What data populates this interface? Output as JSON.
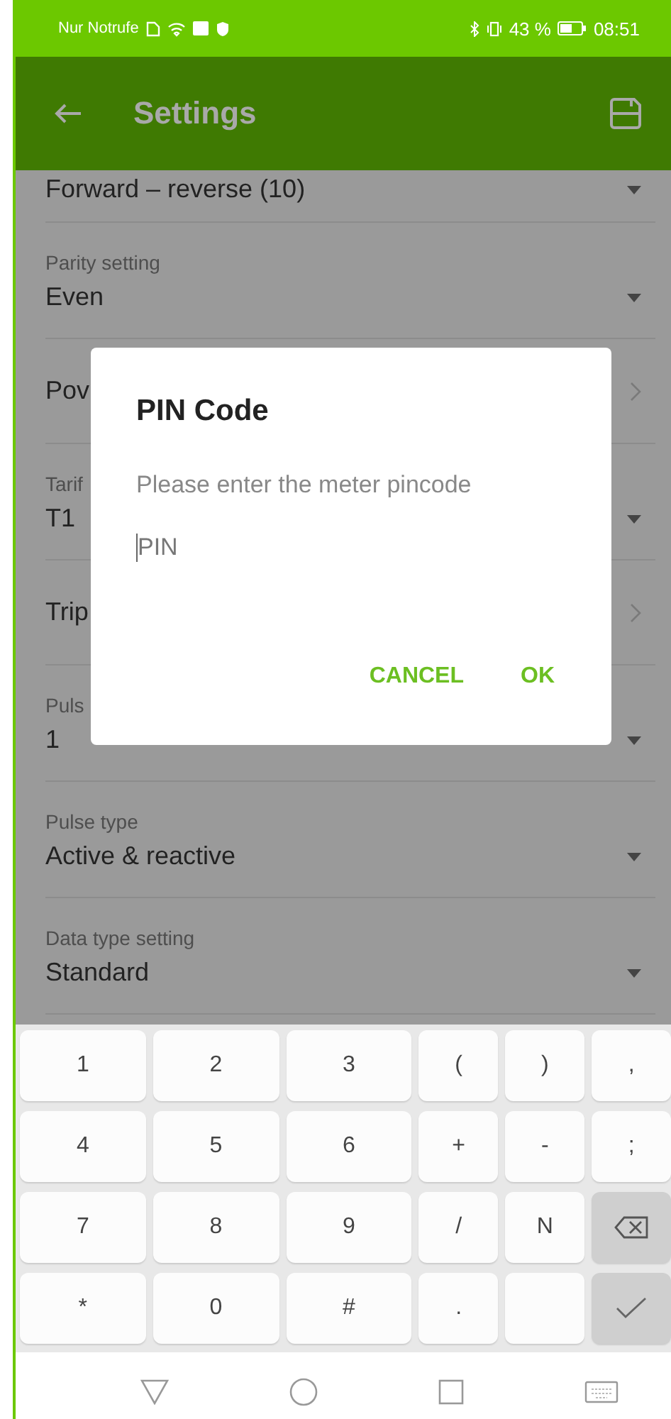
{
  "status_bar": {
    "carrier": "Nur Notrufe",
    "battery_percent": "43 %",
    "time": "08:51"
  },
  "app_bar": {
    "title": "Settings"
  },
  "settings": [
    {
      "kind": "select",
      "value": "Forward – reverse (10)"
    },
    {
      "kind": "select",
      "label": "Parity setting",
      "value": "Even"
    },
    {
      "kind": "link",
      "value": "Pov"
    },
    {
      "kind": "select",
      "label": "Tarif",
      "value": "T1"
    },
    {
      "kind": "link",
      "value": "Trip"
    },
    {
      "kind": "select",
      "label": "Puls",
      "value": "1"
    },
    {
      "kind": "select",
      "label": "Pulse type",
      "value": "Active & reactive"
    },
    {
      "kind": "select",
      "label": "Data type setting",
      "value": "Standard"
    }
  ],
  "dialog": {
    "title": "PIN Code",
    "message": "Please enter the meter pincode",
    "input": {
      "placeholder": "PIN"
    },
    "buttons": [
      "CANCEL",
      "OK"
    ]
  },
  "keyboard": [
    [
      {
        "kind": "char",
        "label": "1"
      },
      {
        "kind": "char",
        "label": "2"
      },
      {
        "kind": "char",
        "label": "3"
      },
      {
        "kind": "char",
        "label": "("
      },
      {
        "kind": "char",
        "label": ")"
      },
      {
        "kind": "char",
        "label": ","
      }
    ],
    [
      {
        "kind": "char",
        "label": "4"
      },
      {
        "kind": "char",
        "label": "5"
      },
      {
        "kind": "char",
        "label": "6"
      },
      {
        "kind": "char",
        "label": "+"
      },
      {
        "kind": "char",
        "label": "-"
      },
      {
        "kind": "char",
        "label": ";"
      }
    ],
    [
      {
        "kind": "char",
        "label": "7"
      },
      {
        "kind": "char",
        "label": "8"
      },
      {
        "kind": "char",
        "label": "9"
      },
      {
        "kind": "char",
        "label": "/"
      },
      {
        "kind": "char",
        "label": "N"
      },
      {
        "kind": "backspace"
      }
    ],
    [
      {
        "kind": "char",
        "label": "*"
      },
      {
        "kind": "char",
        "label": "0"
      },
      {
        "kind": "char",
        "label": "#"
      },
      {
        "kind": "char",
        "label": "."
      },
      {
        "kind": "blank"
      },
      {
        "kind": "enter"
      }
    ]
  ]
}
